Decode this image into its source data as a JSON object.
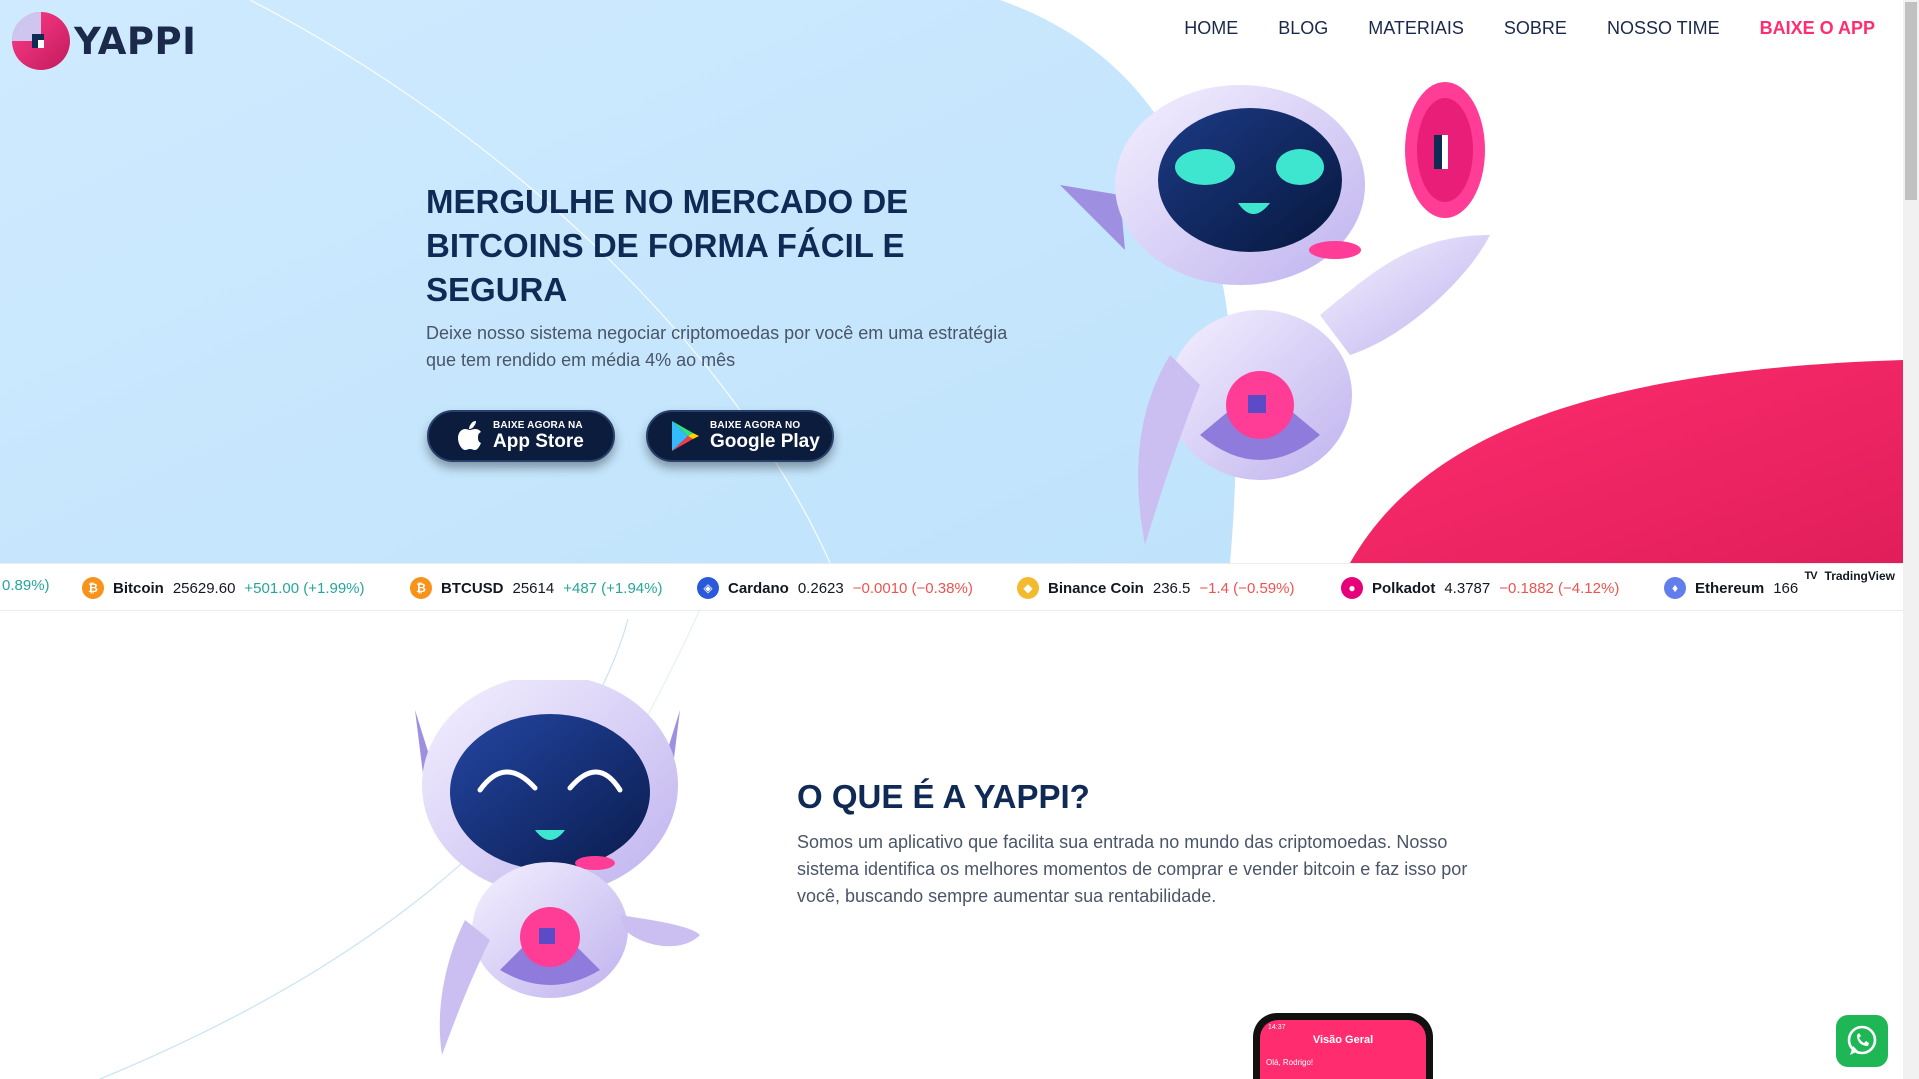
{
  "brand": {
    "name": "YAPPI",
    "accent": "#ff2d6f",
    "navy": "#0f2b55"
  },
  "nav": {
    "items": [
      {
        "label": "HOME"
      },
      {
        "label": "BLOG"
      },
      {
        "label": "MATERIAIS"
      },
      {
        "label": "SOBRE"
      },
      {
        "label": "NOSSO TIME"
      }
    ],
    "cta": "BAIXE O APP"
  },
  "hero": {
    "title": "MERGULHE NO MERCADO DE BITCOINS DE FORMA FÁCIL E SEGURA",
    "subtitle": "Deixe nosso sistema negociar criptomoedas por você em uma estratégia que tem rendido em média 4% ao mês",
    "appstore": {
      "small": "BAIXE AGORA NA",
      "big": "App Store"
    },
    "googleplay": {
      "small": "BAIXE AGORA NO",
      "big": "Google Play"
    }
  },
  "ticker": {
    "leading_fragment": "0.89%)",
    "items": [
      {
        "name": "Bitcoin",
        "price": "25629.60",
        "change": "+501.00 (+1.99%)",
        "direction": "up",
        "icon": "bitcoin-icon",
        "color": "#f7931a"
      },
      {
        "name": "BTCUSD",
        "price": "25614",
        "change": "+487 (+1.94%)",
        "direction": "up",
        "icon": "bitcoin-icon",
        "color": "#f7931a"
      },
      {
        "name": "Cardano",
        "price": "0.2623",
        "change": "−0.0010 (−0.38%)",
        "direction": "down",
        "icon": "cardano-icon",
        "color": "#2a5ada"
      },
      {
        "name": "Binance Coin",
        "price": "236.5",
        "change": "−1.4 (−0.59%)",
        "direction": "down",
        "icon": "binance-icon",
        "color": "#f3ba2f"
      },
      {
        "name": "Polkadot",
        "price": "4.3787",
        "change": "−0.1882 (−4.12%)",
        "direction": "down",
        "icon": "polkadot-icon",
        "color": "#e6007a"
      },
      {
        "name": "Ethereum",
        "price": "166",
        "change": "",
        "direction": "up",
        "icon": "ethereum-icon",
        "color": "#627eea"
      }
    ],
    "attribution": "TradingView"
  },
  "about": {
    "title": "O QUE É A YAPPI?",
    "text": "Somos um aplicativo que facilita sua entrada no mundo das criptomoedas. Nosso sistema identifica os melhores momentos de comprar e vender bitcoin e faz isso por você, buscando sempre aumentar sua rentabilidade."
  },
  "phone": {
    "screen_title": "Visão Geral",
    "greeting": "Olá, Rodrigo!",
    "time": "14:37"
  }
}
